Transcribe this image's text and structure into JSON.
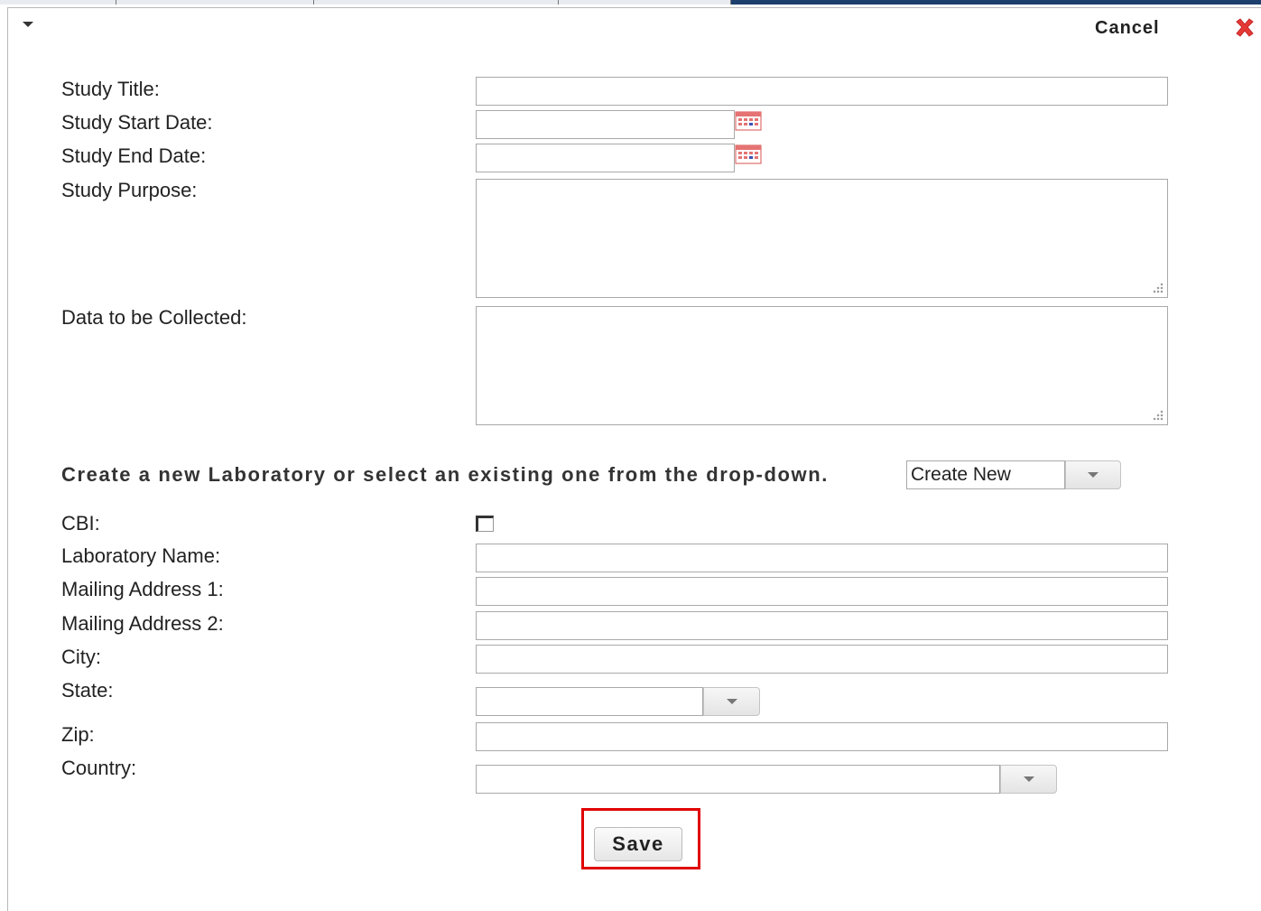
{
  "header": {
    "cancel_label": "Cancel"
  },
  "study": {
    "title_label": "Study Title:",
    "start_date_label": "Study Start Date:",
    "end_date_label": "Study End Date:",
    "purpose_label": "Study Purpose:",
    "data_collected_label": "Data to be Collected:"
  },
  "lab_section": {
    "prompt": "Create a new Laboratory or select an existing one from the drop-down.",
    "lab_select_value": "Create New"
  },
  "lab": {
    "cbi_label": "CBI:",
    "name_label": "Laboratory Name:",
    "address1_label": "Mailing Address 1:",
    "address2_label": "Mailing Address 2:",
    "city_label": "City:",
    "state_label": "State:",
    "zip_label": "Zip:",
    "country_label": "Country:"
  },
  "actions": {
    "save_label": "Save"
  },
  "colors": {
    "active_tab": "#1c3f6e",
    "close_icon": "#e53935",
    "highlight_border": "#e00000"
  },
  "icons": [
    "collapse-arrow-icon",
    "close-icon",
    "calendar-icon",
    "chevron-down-icon",
    "resize-grip-icon"
  ]
}
